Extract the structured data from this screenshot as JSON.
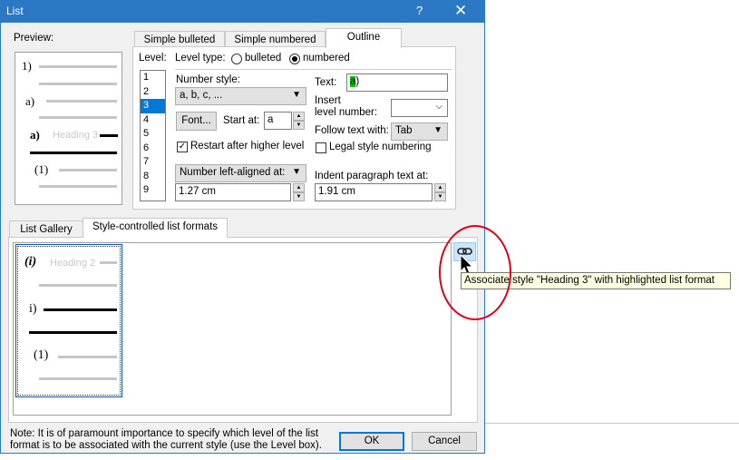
{
  "window": {
    "title": "List",
    "help": "?",
    "close": "✕"
  },
  "preview": {
    "label": "Preview:",
    "items": [
      {
        "marker": "1)"
      },
      {
        "marker": "a)"
      },
      {
        "marker": "a)",
        "heading": "Heading 3"
      },
      {
        "marker": "(1)"
      }
    ]
  },
  "tabs": [
    {
      "label": "Simple bulleted",
      "active": false
    },
    {
      "label": "Simple numbered",
      "active": false
    },
    {
      "label": "Outline",
      "active": true
    }
  ],
  "outline": {
    "level_label": "Level:",
    "levels": [
      "1",
      "2",
      "3",
      "4",
      "5",
      "6",
      "7",
      "8",
      "9"
    ],
    "selected_level": "3",
    "level_type_label": "Level type:",
    "bulleted_label": "bulleted",
    "numbered_label": "numbered",
    "level_type_value": "numbered",
    "number_style_label": "Number style:",
    "number_style_value": "a, b, c, ...",
    "text_label": "Text:",
    "text_highlight": "a",
    "text_rest": ")",
    "insert_label_1": "Insert",
    "insert_label_2": "level number:",
    "insert_value": "",
    "font_button": "Font...",
    "start_at_label": "Start at:",
    "start_at_value": "a",
    "follow_label": "Follow text with:",
    "follow_value": "Tab",
    "restart_label": "Restart after higher level",
    "restart_checked": true,
    "legal_label": "Legal style numbering",
    "legal_checked": false,
    "alignment_value": "Number left-aligned at:",
    "alignment_measure": "1.27 cm",
    "indent_label": "Indent paragraph text at:",
    "indent_measure": "1.91 cm"
  },
  "bottom_tabs": [
    {
      "label": "List Gallery",
      "active": false
    },
    {
      "label": "Style-controlled list formats",
      "active": true
    }
  ],
  "gallery": {
    "items": [
      {
        "marker": "(i)",
        "heading": "Heading 2"
      },
      {
        "marker": "i)"
      },
      {
        "marker": "(1)"
      }
    ]
  },
  "associate": {
    "icon": "link-icon",
    "tooltip": "Associate style \"Heading 3\" with highlighted list format"
  },
  "note": {
    "line1": "Note: It is of paramount importance to specify which level of the list",
    "line2": "format is to be associated with the current style (use the Level box)."
  },
  "buttons": {
    "ok": "OK",
    "cancel": "Cancel"
  },
  "colors": {
    "accent": "#2b78c5",
    "selection": "#0078d7",
    "text_highlight": "#00c800",
    "annotation": "#e0001b"
  }
}
